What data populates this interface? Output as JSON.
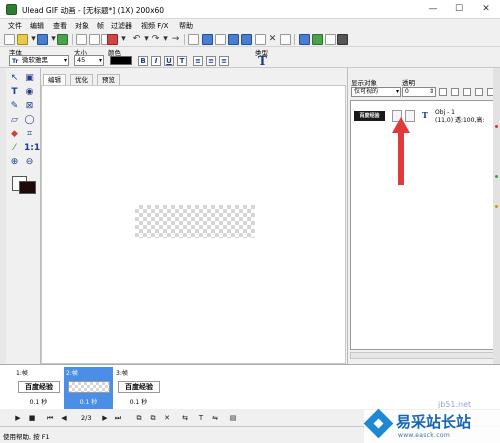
{
  "window": {
    "title": "Ulead GIF 动画 - [无标题*] (1X) 200x60",
    "minimize": "—",
    "maximize": "☐",
    "close": "✕"
  },
  "menu": [
    "文件",
    "编辑",
    "查看",
    "对象",
    "帧",
    "过滤器",
    "视频 F/X",
    "帮助"
  ],
  "text_toolbar": {
    "font_label": "字体",
    "font_value": "微软雅黑",
    "size_label": "大小",
    "size_value": "45",
    "color_label": "颜色",
    "style_buttons": [
      "B",
      "I",
      "U",
      "T"
    ],
    "align_buttons": [
      "≡",
      "≡",
      "≡"
    ],
    "type_label": "类型",
    "type_icon": "T"
  },
  "tabs": [
    "编辑",
    "优化",
    "预览"
  ],
  "right_panel": {
    "show_objects_label": "显示对象",
    "transparency_label": "透明",
    "visibility_value": "仅可视的",
    "transparency_value": "0",
    "object": {
      "thumb_text": "百度经验",
      "type_glyph": "T",
      "line1": "Obj - 1",
      "line2": "(11,0) 透:100,高:"
    }
  },
  "frames": [
    {
      "label": "1:帧",
      "thumb": "百度经验",
      "delay": "0.1 秒"
    },
    {
      "label": "2:帧",
      "thumb": "",
      "delay": "0.1 秒"
    },
    {
      "label": "3:帧",
      "thumb": "百度经验",
      "delay": "0.1 秒"
    }
  ],
  "playback": {
    "frame_counter": "2/3"
  },
  "status": {
    "text": "使用帮助, 按 F1"
  },
  "watermark": {
    "small": "jb51.net",
    "main": "易采站长站",
    "url": "www.easck.com"
  },
  "colors": {
    "selected_frame": "#4a8ee8",
    "arrow": "#e03a3a",
    "foreground_color": "#1b0a08",
    "text_color_swatch": "#000000"
  }
}
